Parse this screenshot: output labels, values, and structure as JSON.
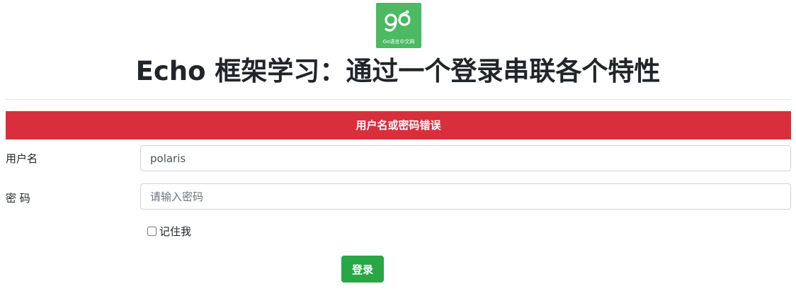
{
  "logo": {
    "icon": "gopher-logo-icon",
    "caption": "Go语言中文网",
    "background": "#4cb963"
  },
  "page": {
    "title": "Echo 框架学习：通过一个登录串联各个特性"
  },
  "alert": {
    "message": "用户名或密码错误",
    "color": "#d92f3d"
  },
  "form": {
    "username": {
      "label": "用户名",
      "value": "polaris"
    },
    "password": {
      "label": "密 码",
      "placeholder": "请输入密码",
      "value": ""
    },
    "remember": {
      "label": "记住我",
      "checked": false
    },
    "submit": {
      "label": "登录",
      "color": "#28a745"
    }
  }
}
